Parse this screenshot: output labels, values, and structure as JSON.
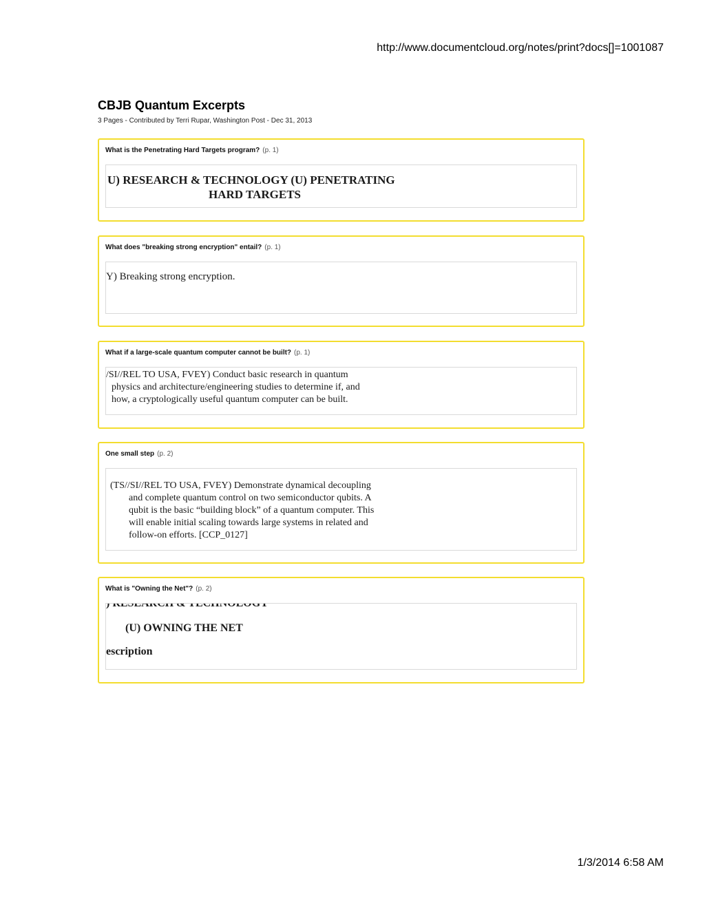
{
  "print": {
    "url": "http://www.documentcloud.org/notes/print?docs[]=1001087",
    "datetime": "1/3/2014 6:58 AM"
  },
  "document": {
    "title": "CBJB Quantum Excerpts",
    "meta": "3 Pages - Contributed by Terri Rupar, Washington Post - Dec 31, 2013"
  },
  "notes": [
    {
      "question": "What is the Penetrating Hard Targets program?",
      "page": "(p. 1)",
      "excerpt_lines": [
        "U) RESEARCH & TECHNOLOGY (U) PENETRATING",
        "HARD TARGETS"
      ]
    },
    {
      "question": "What does \"breaking strong encryption\" entail?",
      "page": "(p. 1)",
      "excerpt_lines": [
        "Y) Breaking strong encryption."
      ]
    },
    {
      "question": "What if a large-scale quantum computer cannot be built?",
      "page": "(p. 1)",
      "excerpt_lines": [
        "/SI//REL TO USA, FVEY) Conduct basic research in quantum",
        "physics and architecture/engineering studies to determine if, and",
        "how, a cryptologically useful quantum computer can be built."
      ]
    },
    {
      "question": "One small step",
      "page": "(p. 2)",
      "excerpt_lines": [
        "(TS//SI//REL TO USA, FVEY) Demonstrate dynamical decoupling",
        "and complete quantum control on two semiconductor qubits. A",
        "qubit is the basic “building block” of a quantum computer. This",
        "will enable initial scaling towards large systems in related and",
        "follow-on efforts. [CCP_0127]"
      ]
    },
    {
      "question": "What is \"Owning the Net\"?",
      "page": "(p. 2)",
      "excerpt_lines": [
        ") RESEARCH & TECHNOLOGY",
        "(U) OWNING THE NET",
        "escription"
      ]
    }
  ]
}
